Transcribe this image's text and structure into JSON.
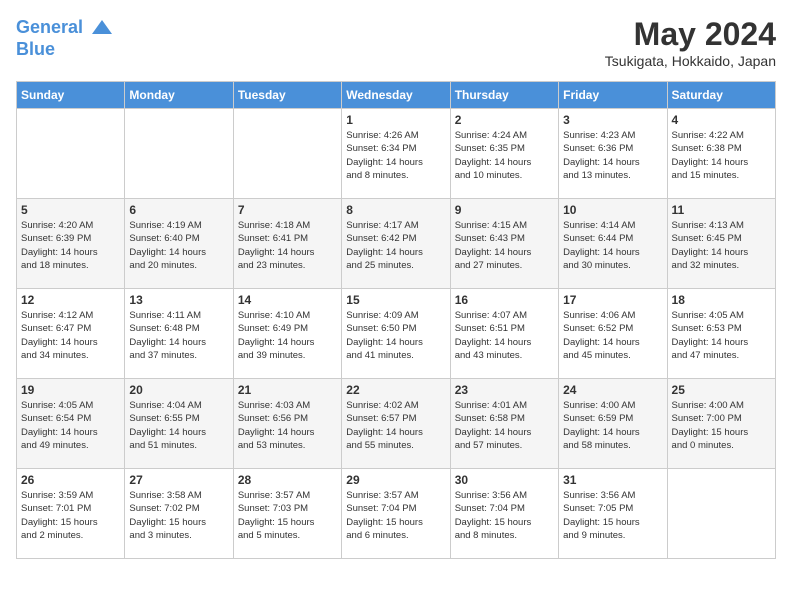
{
  "header": {
    "logo_line1": "General",
    "logo_line2": "Blue",
    "month_title": "May 2024",
    "location": "Tsukigata, Hokkaido, Japan"
  },
  "days_of_week": [
    "Sunday",
    "Monday",
    "Tuesday",
    "Wednesday",
    "Thursday",
    "Friday",
    "Saturday"
  ],
  "weeks": [
    [
      {
        "day": "",
        "info": ""
      },
      {
        "day": "",
        "info": ""
      },
      {
        "day": "",
        "info": ""
      },
      {
        "day": "1",
        "info": "Sunrise: 4:26 AM\nSunset: 6:34 PM\nDaylight: 14 hours\nand 8 minutes."
      },
      {
        "day": "2",
        "info": "Sunrise: 4:24 AM\nSunset: 6:35 PM\nDaylight: 14 hours\nand 10 minutes."
      },
      {
        "day": "3",
        "info": "Sunrise: 4:23 AM\nSunset: 6:36 PM\nDaylight: 14 hours\nand 13 minutes."
      },
      {
        "day": "4",
        "info": "Sunrise: 4:22 AM\nSunset: 6:38 PM\nDaylight: 14 hours\nand 15 minutes."
      }
    ],
    [
      {
        "day": "5",
        "info": "Sunrise: 4:20 AM\nSunset: 6:39 PM\nDaylight: 14 hours\nand 18 minutes."
      },
      {
        "day": "6",
        "info": "Sunrise: 4:19 AM\nSunset: 6:40 PM\nDaylight: 14 hours\nand 20 minutes."
      },
      {
        "day": "7",
        "info": "Sunrise: 4:18 AM\nSunset: 6:41 PM\nDaylight: 14 hours\nand 23 minutes."
      },
      {
        "day": "8",
        "info": "Sunrise: 4:17 AM\nSunset: 6:42 PM\nDaylight: 14 hours\nand 25 minutes."
      },
      {
        "day": "9",
        "info": "Sunrise: 4:15 AM\nSunset: 6:43 PM\nDaylight: 14 hours\nand 27 minutes."
      },
      {
        "day": "10",
        "info": "Sunrise: 4:14 AM\nSunset: 6:44 PM\nDaylight: 14 hours\nand 30 minutes."
      },
      {
        "day": "11",
        "info": "Sunrise: 4:13 AM\nSunset: 6:45 PM\nDaylight: 14 hours\nand 32 minutes."
      }
    ],
    [
      {
        "day": "12",
        "info": "Sunrise: 4:12 AM\nSunset: 6:47 PM\nDaylight: 14 hours\nand 34 minutes."
      },
      {
        "day": "13",
        "info": "Sunrise: 4:11 AM\nSunset: 6:48 PM\nDaylight: 14 hours\nand 37 minutes."
      },
      {
        "day": "14",
        "info": "Sunrise: 4:10 AM\nSunset: 6:49 PM\nDaylight: 14 hours\nand 39 minutes."
      },
      {
        "day": "15",
        "info": "Sunrise: 4:09 AM\nSunset: 6:50 PM\nDaylight: 14 hours\nand 41 minutes."
      },
      {
        "day": "16",
        "info": "Sunrise: 4:07 AM\nSunset: 6:51 PM\nDaylight: 14 hours\nand 43 minutes."
      },
      {
        "day": "17",
        "info": "Sunrise: 4:06 AM\nSunset: 6:52 PM\nDaylight: 14 hours\nand 45 minutes."
      },
      {
        "day": "18",
        "info": "Sunrise: 4:05 AM\nSunset: 6:53 PM\nDaylight: 14 hours\nand 47 minutes."
      }
    ],
    [
      {
        "day": "19",
        "info": "Sunrise: 4:05 AM\nSunset: 6:54 PM\nDaylight: 14 hours\nand 49 minutes."
      },
      {
        "day": "20",
        "info": "Sunrise: 4:04 AM\nSunset: 6:55 PM\nDaylight: 14 hours\nand 51 minutes."
      },
      {
        "day": "21",
        "info": "Sunrise: 4:03 AM\nSunset: 6:56 PM\nDaylight: 14 hours\nand 53 minutes."
      },
      {
        "day": "22",
        "info": "Sunrise: 4:02 AM\nSunset: 6:57 PM\nDaylight: 14 hours\nand 55 minutes."
      },
      {
        "day": "23",
        "info": "Sunrise: 4:01 AM\nSunset: 6:58 PM\nDaylight: 14 hours\nand 57 minutes."
      },
      {
        "day": "24",
        "info": "Sunrise: 4:00 AM\nSunset: 6:59 PM\nDaylight: 14 hours\nand 58 minutes."
      },
      {
        "day": "25",
        "info": "Sunrise: 4:00 AM\nSunset: 7:00 PM\nDaylight: 15 hours\nand 0 minutes."
      }
    ],
    [
      {
        "day": "26",
        "info": "Sunrise: 3:59 AM\nSunset: 7:01 PM\nDaylight: 15 hours\nand 2 minutes."
      },
      {
        "day": "27",
        "info": "Sunrise: 3:58 AM\nSunset: 7:02 PM\nDaylight: 15 hours\nand 3 minutes."
      },
      {
        "day": "28",
        "info": "Sunrise: 3:57 AM\nSunset: 7:03 PM\nDaylight: 15 hours\nand 5 minutes."
      },
      {
        "day": "29",
        "info": "Sunrise: 3:57 AM\nSunset: 7:04 PM\nDaylight: 15 hours\nand 6 minutes."
      },
      {
        "day": "30",
        "info": "Sunrise: 3:56 AM\nSunset: 7:04 PM\nDaylight: 15 hours\nand 8 minutes."
      },
      {
        "day": "31",
        "info": "Sunrise: 3:56 AM\nSunset: 7:05 PM\nDaylight: 15 hours\nand 9 minutes."
      },
      {
        "day": "",
        "info": ""
      }
    ]
  ]
}
